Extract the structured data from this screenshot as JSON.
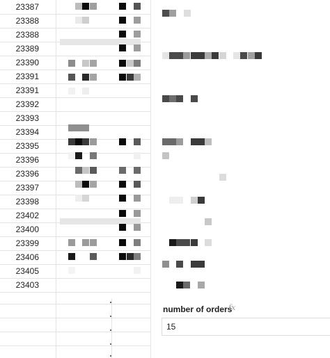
{
  "sheet": {
    "rows": [
      {
        "order_id": "23387"
      },
      {
        "order_id": "23388"
      },
      {
        "order_id": "23388"
      },
      {
        "order_id": "23389"
      },
      {
        "order_id": "23390"
      },
      {
        "order_id": "23391"
      },
      {
        "order_id": "23391"
      },
      {
        "order_id": "23392"
      },
      {
        "order_id": "23393"
      },
      {
        "order_id": "23394"
      },
      {
        "order_id": "23395"
      },
      {
        "order_id": "23396"
      },
      {
        "order_id": "23396"
      },
      {
        "order_id": "23397"
      },
      {
        "order_id": "23398"
      },
      {
        "order_id": "23402"
      },
      {
        "order_id": "23400"
      },
      {
        "order_id": "23399"
      },
      {
        "order_id": "23406"
      },
      {
        "order_id": "23405"
      },
      {
        "order_id": "23403"
      }
    ]
  },
  "panel": {
    "label": "number of orders",
    "fx_icon": "function-icon",
    "fx_glyph": "fx",
    "value": "15"
  },
  "colors": {
    "grid": "#e3e3e3",
    "text": "#1f1f1f",
    "redaction_band": "#e6e6e6"
  }
}
